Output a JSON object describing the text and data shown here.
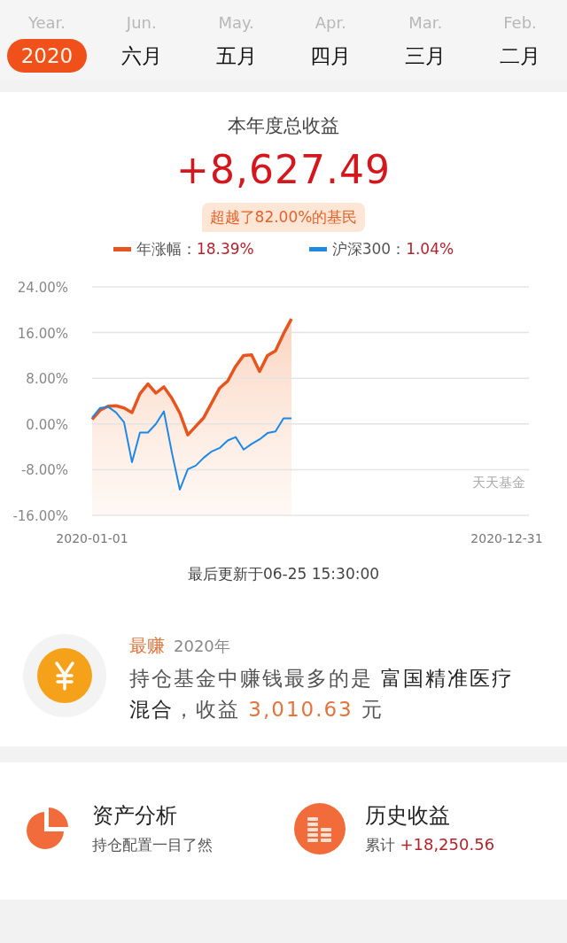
{
  "month_tabs": [
    {
      "label": "Year.",
      "value": "2020",
      "selected": true
    },
    {
      "label": "Jun.",
      "value": "六月",
      "selected": false
    },
    {
      "label": "May.",
      "value": "五月",
      "selected": false
    },
    {
      "label": "Apr.",
      "value": "四月",
      "selected": false
    },
    {
      "label": "Mar.",
      "value": "三月",
      "selected": false
    },
    {
      "label": "Feb.",
      "value": "二月",
      "selected": false
    }
  ],
  "summary": {
    "title": "本年度总收益",
    "amount": "+8,627.49",
    "rank_badge": "超越了82.00%的基民",
    "legend": [
      {
        "separator": "：",
        "value": "18.39%"
      },
      {
        "separator": "：",
        "value": "1.04%"
      }
    ],
    "chart_data": {
      "type": "line",
      "grid": true,
      "categories": [
        "2020-01-01",
        null,
        null,
        null,
        null,
        null,
        null,
        null,
        null,
        null,
        null,
        null,
        null,
        null,
        null,
        null,
        null,
        null,
        null,
        null,
        null,
        null,
        null,
        null,
        null,
        null,
        null,
        null,
        null,
        null,
        null,
        null,
        null,
        null,
        null,
        null,
        null,
        null,
        null,
        null,
        null,
        null,
        null,
        null,
        null,
        null,
        null,
        null,
        null,
        null,
        null,
        null,
        "2020-12-31"
      ],
      "ylim": [
        -16,
        24
      ],
      "yticks": [
        {
          "value": 24,
          "label": "24.00%"
        },
        {
          "value": 16,
          "label": "16.00%"
        },
        {
          "value": 8,
          "label": "8.00%"
        },
        {
          "value": 0,
          "label": "0.00%"
        },
        {
          "value": -8,
          "label": "-8.00%"
        },
        {
          "value": -16,
          "label": "-16.00%"
        }
      ],
      "series": [
        {
          "name": "年涨幅",
          "color": "#e8541e",
          "values": [
            0.8,
            2.4,
            3.1,
            3.2,
            2.8,
            2,
            5.3,
            7,
            5.4,
            6.5,
            4.5,
            1.9,
            -1.9,
            -0.4,
            1.1,
            3.7,
            6.3,
            7.5,
            10.1,
            12,
            12.1,
            9.2,
            12,
            12.8,
            15.8,
            18.4,
            null,
            null,
            null,
            null,
            null,
            null,
            null,
            null,
            null,
            null,
            null,
            null,
            null,
            null,
            null,
            null,
            null,
            null,
            null,
            null,
            null,
            null,
            null,
            null,
            null,
            null,
            null
          ]
        },
        {
          "name": "沪深300",
          "color": "#1e88e5",
          "values": [
            1.1,
            2.8,
            3,
            2,
            0.3,
            -6.7,
            -1.5,
            -1.5,
            0,
            2.2,
            -5,
            -11.5,
            -7.9,
            -7.3,
            -5.9,
            -4.8,
            -4.2,
            -2.9,
            -2.3,
            -4.5,
            -3.5,
            -2.7,
            -1.6,
            -1.3,
            1,
            1,
            null,
            null,
            null,
            null,
            null,
            null,
            null,
            null,
            null,
            null,
            null,
            null,
            null,
            null,
            null,
            null,
            null,
            null,
            null,
            null,
            null,
            null,
            null,
            null,
            null,
            null,
            null
          ]
        }
      ],
      "annotations": [
        {
          "text": "天天基金"
        }
      ]
    },
    "updated": "最后更新于06-25 15:30:00"
  },
  "top_earner": {
    "label": "最赚",
    "year": "2020年",
    "sentence": [
      {
        "kind": "plain",
        "text": "持仓基金中赚钱最多的是 "
      },
      {
        "kind": "fund",
        "text": "富国精准医疗混合"
      },
      {
        "kind": "plain",
        "text": "，收益 "
      },
      {
        "kind": "amount",
        "text": "3,010.63"
      },
      {
        "kind": "plain",
        "text": " 元"
      }
    ]
  },
  "shortcuts": [
    {
      "kind": "pie",
      "title": "资产分析",
      "subtitle": "持仓配置一目了然"
    },
    {
      "kind": "coins",
      "title": "历史收益",
      "prefix": "累计",
      "value": "+18,250.56"
    }
  ]
}
